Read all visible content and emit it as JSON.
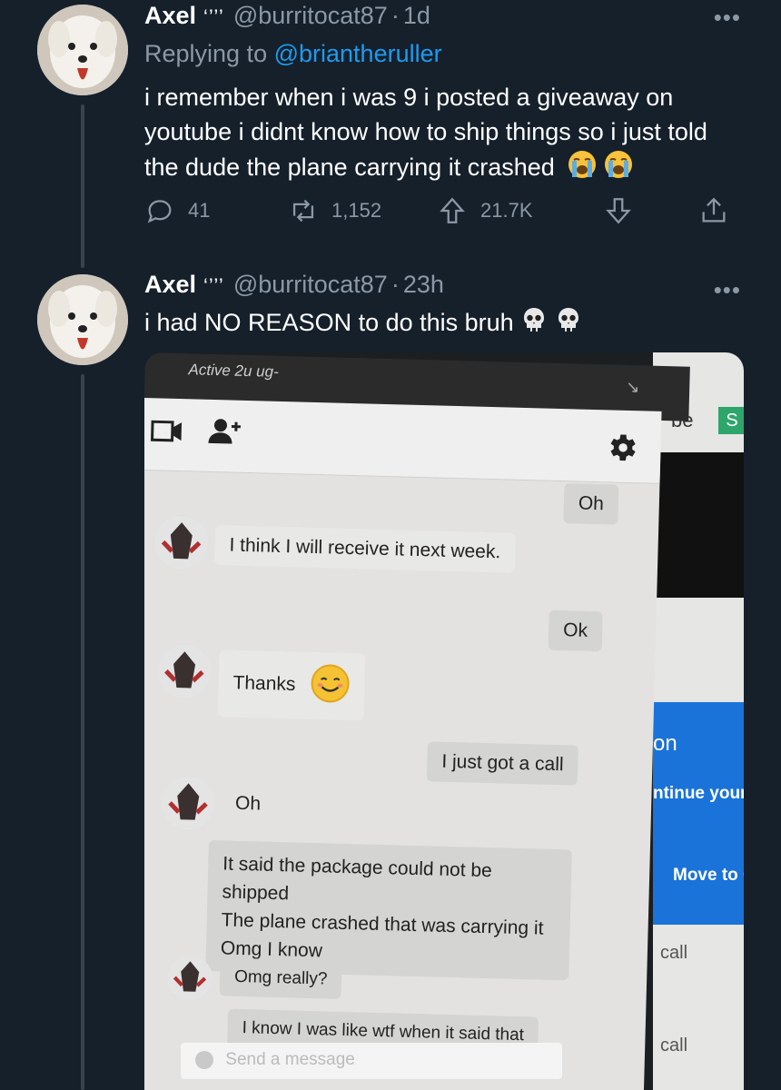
{
  "tweets": [
    {
      "name": "Axel",
      "name_decoration": "‘’’’",
      "handle": "@burritocat87",
      "time": "1d",
      "replying_label": "Replying to",
      "replying_to": "@briantheruller",
      "text": "i remember when i was 9 i posted a giveaway on youtube i didnt know how to ship things so i just told the dude the plane carrying it crashed",
      "emojis": [
        "loudly-crying-face-icon",
        "loudly-crying-face-icon"
      ],
      "replies": "41",
      "retweets": "1,152",
      "upvotes": "21.7K"
    },
    {
      "name": "Axel",
      "name_decoration": "‘’’’",
      "handle": "@burritocat87",
      "time": "23h",
      "text": "i had NO REASON to do this bruh",
      "emojis": [
        "skull-icon",
        "skull-icon"
      ]
    }
  ],
  "photo": {
    "top_bar_text": "Active 2u ug-",
    "right_screen": {
      "text_be": "be",
      "text_s": "S",
      "text_on": "on",
      "text_continue": "ntinue your H",
      "text_move": "Move to Go",
      "text_call_1": "call",
      "text_call_2": "call"
    },
    "messages": [
      {
        "side": "right",
        "text": "Oh"
      },
      {
        "side": "left",
        "text": "I think I will receive it next week."
      },
      {
        "side": "right",
        "text": "Ok"
      },
      {
        "side": "left",
        "text": "Thanks"
      },
      {
        "side": "right",
        "text": "I just got a call"
      },
      {
        "side": "left",
        "text": "Oh"
      },
      {
        "side": "left",
        "text": "It said the package could not be shipped"
      },
      {
        "side": "left",
        "text": "The plane crashed that was carrying it"
      },
      {
        "side": "left",
        "text": "Omg I know"
      },
      {
        "side": "left",
        "text": "Omg really?"
      },
      {
        "side": "left",
        "text": "I know I was like wtf when it said that"
      }
    ],
    "composer_placeholder": "Send a message"
  },
  "colors": {
    "background": "#15202b",
    "secondary_text": "#8b98a5",
    "link": "#1d9bf0",
    "thread_line": "#38444d"
  }
}
